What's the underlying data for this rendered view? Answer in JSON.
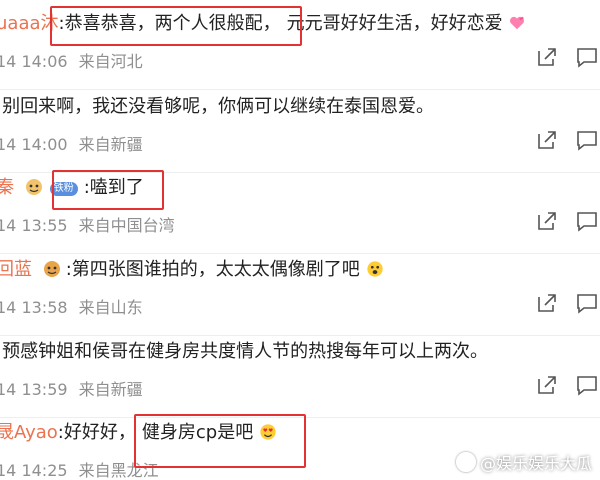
{
  "comments": [
    {
      "user": "uaaa沐",
      "text_a": ":恭喜恭喜，两个人很般配，",
      "text_b": "元元哥好好生活，好好恋爱",
      "emoji": "heart-emoji",
      "time": "14 14:06",
      "location": "来自河北"
    },
    {
      "user": "",
      "text_a": ":别回来啊，我还没看够呢，你俩可以继续在泰国恩爱。",
      "time": "14 14:00",
      "location": "来自新疆"
    },
    {
      "user": "秦",
      "badge": "铁粉",
      "text_a": ":嗑到了",
      "time": "14 13:55",
      "location": "来自中国台湾"
    },
    {
      "user": "回蓝",
      "text_a": ":第四张图谁拍的，太太太偶像剧了吧",
      "emoji": "scared-emoji",
      "time": "14 13:58",
      "location": "来自山东"
    },
    {
      "user": "",
      "text_a": ":预感钟姐和侯哥在健身房共度情人节的热搜每年可以上两次。",
      "time": "14 13:59",
      "location": "来自新疆"
    },
    {
      "user": "晟Ayao",
      "text_a": ":好好好，",
      "text_b": "健身房cp是吧",
      "emoji": "heart-eyes-emoji",
      "time": "14 14:25",
      "location": "来自黑龙江"
    }
  ],
  "watermark": "@娱乐娱乐大瓜",
  "colors": {
    "username": "#eb7350",
    "meta": "#8f8f8f",
    "highlight": "#e23232"
  }
}
